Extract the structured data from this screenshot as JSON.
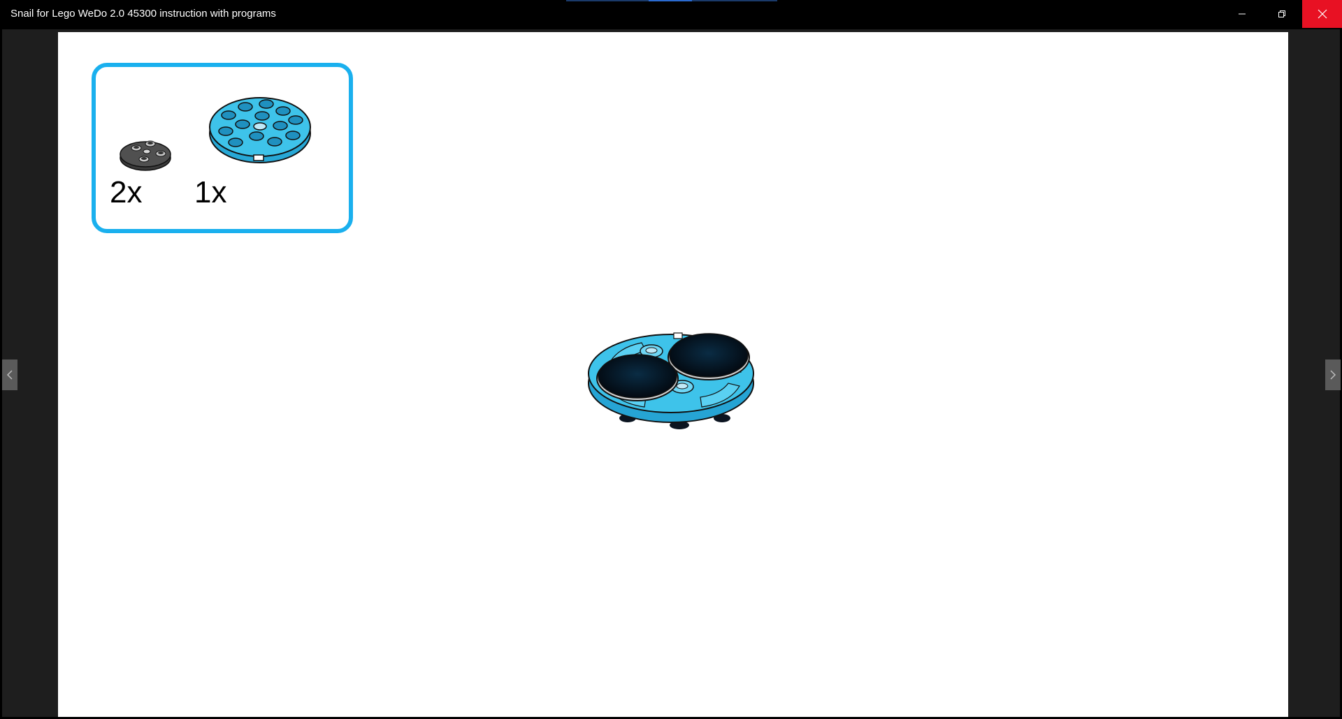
{
  "window": {
    "title": "Snail for Lego WeDo 2.0 45300 instruction with programs",
    "minimize_icon": "minimize-icon",
    "maximize_icon": "restore-icon",
    "close_icon": "close-icon",
    "close_color": "#e81123"
  },
  "viewer": {
    "prev_icon": "chevron-left-icon",
    "next_icon": "chevron-right-icon"
  },
  "parts": {
    "border_color": "#1ab0ee",
    "items": [
      {
        "quantity": "2x",
        "part": "black-round-plate-2x2-icon"
      },
      {
        "quantity": "1x",
        "part": "azure-round-plate-4x4-icon"
      }
    ]
  },
  "model": {
    "image": "assembled-base-icon",
    "colors": {
      "azure": "#3ec3ea",
      "black": "#0b1420"
    }
  }
}
